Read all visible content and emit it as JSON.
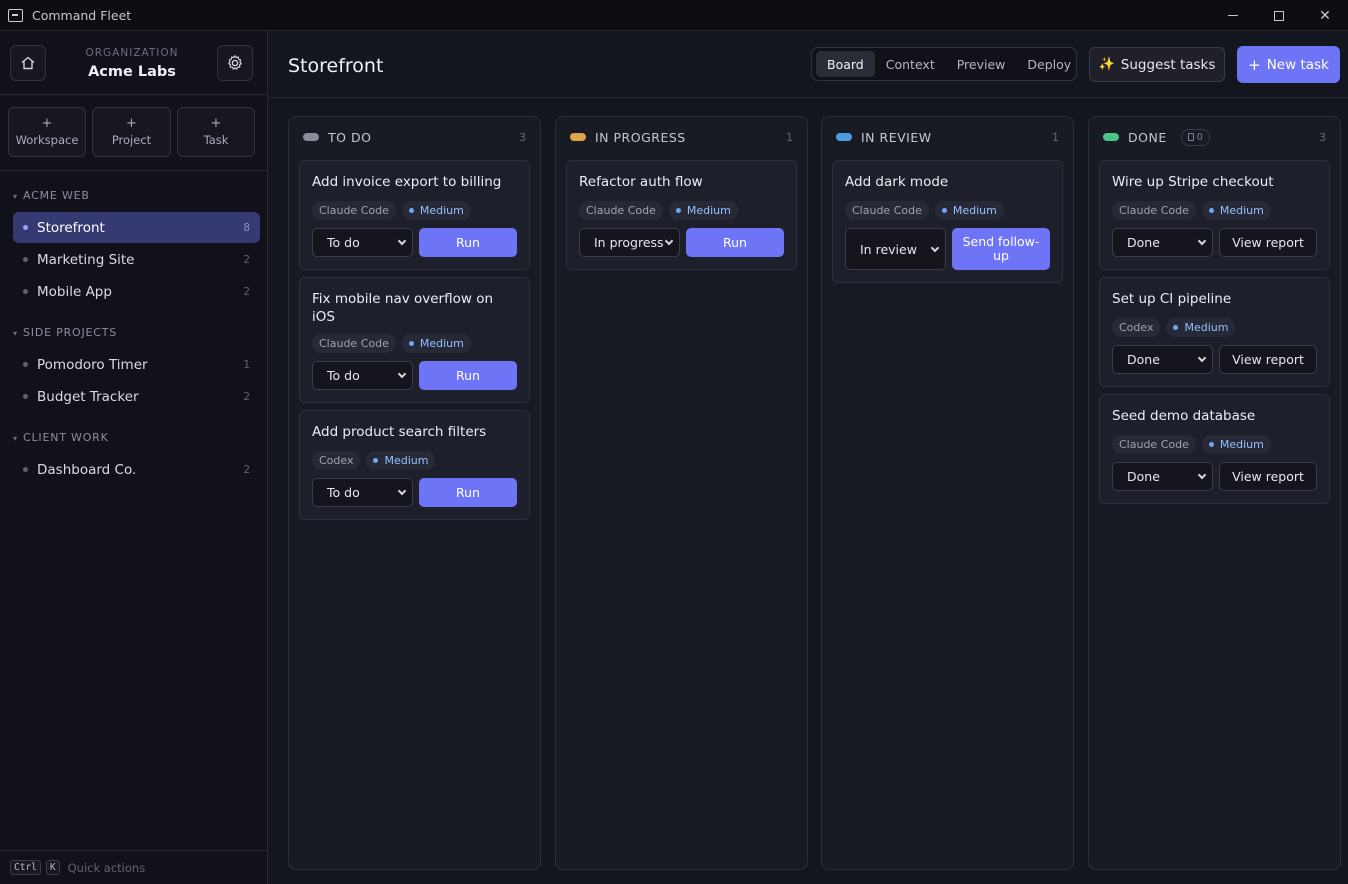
{
  "window": {
    "title": "Command Fleet"
  },
  "sidebar": {
    "org_label": "ORGANIZATION",
    "org_name": "Acme Labs",
    "create": [
      {
        "plus": "+",
        "label": "Workspace"
      },
      {
        "plus": "+",
        "label": "Project"
      },
      {
        "plus": "+",
        "label": "Task"
      }
    ],
    "sections": [
      {
        "title": "ACME WEB",
        "projects": [
          {
            "name": "Storefront",
            "count": "8",
            "active": true
          },
          {
            "name": "Marketing Site",
            "count": "2"
          },
          {
            "name": "Mobile App",
            "count": "2"
          }
        ]
      },
      {
        "title": "SIDE PROJECTS",
        "projects": [
          {
            "name": "Pomodoro Timer",
            "count": "1"
          },
          {
            "name": "Budget Tracker",
            "count": "2"
          }
        ]
      },
      {
        "title": "CLIENT WORK",
        "projects": [
          {
            "name": "Dashboard Co.",
            "count": "2"
          }
        ]
      }
    ],
    "footer": {
      "key1": "Ctrl",
      "key2": "K",
      "text": "Quick actions"
    }
  },
  "header": {
    "title": "Storefront",
    "tabs": [
      "Board",
      "Context",
      "Preview",
      "Deploy"
    ],
    "active_tab": "Board",
    "suggest_label": "Suggest tasks",
    "new_label": "New task"
  },
  "colors": {
    "accent": "#6e74f6",
    "todo": "#8a8d99",
    "in_progress": "#e0a44a",
    "in_review": "#4f9be0",
    "done": "#4cc38a"
  },
  "columns": [
    {
      "title": "TO DO",
      "count": "3",
      "cards": [
        {
          "title": "Add invoice export to billing",
          "agent": "Claude Code",
          "priority": "Medium",
          "status": "To do",
          "action": "Run"
        },
        {
          "title": "Fix mobile nav overflow on iOS",
          "agent": "Claude Code",
          "priority": "Medium",
          "status": "To do",
          "action": "Run"
        },
        {
          "title": "Add product search filters",
          "agent": "Codex",
          "priority": "Medium",
          "status": "To do",
          "action": "Run"
        }
      ]
    },
    {
      "title": "IN PROGRESS",
      "count": "1",
      "cards": [
        {
          "title": "Refactor auth flow",
          "agent": "Claude Code",
          "priority": "Medium",
          "status": "In progress",
          "action": "Run"
        }
      ]
    },
    {
      "title": "IN REVIEW",
      "count": "1",
      "cards": [
        {
          "title": "Add dark mode",
          "agent": "Claude Code",
          "priority": "Medium",
          "status": "In review",
          "action": "Send follow-up"
        }
      ]
    },
    {
      "title": "DONE",
      "count": "3",
      "badge": "0",
      "cards": [
        {
          "title": "Wire up Stripe checkout",
          "agent": "Claude Code",
          "priority": "Medium",
          "status": "Done",
          "action": "View report"
        },
        {
          "title": "Set up CI pipeline",
          "agent": "Codex",
          "priority": "Medium",
          "status": "Done",
          "action": "View report"
        },
        {
          "title": "Seed demo database",
          "agent": "Claude Code",
          "priority": "Medium",
          "status": "Done",
          "action": "View report"
        }
      ]
    }
  ]
}
